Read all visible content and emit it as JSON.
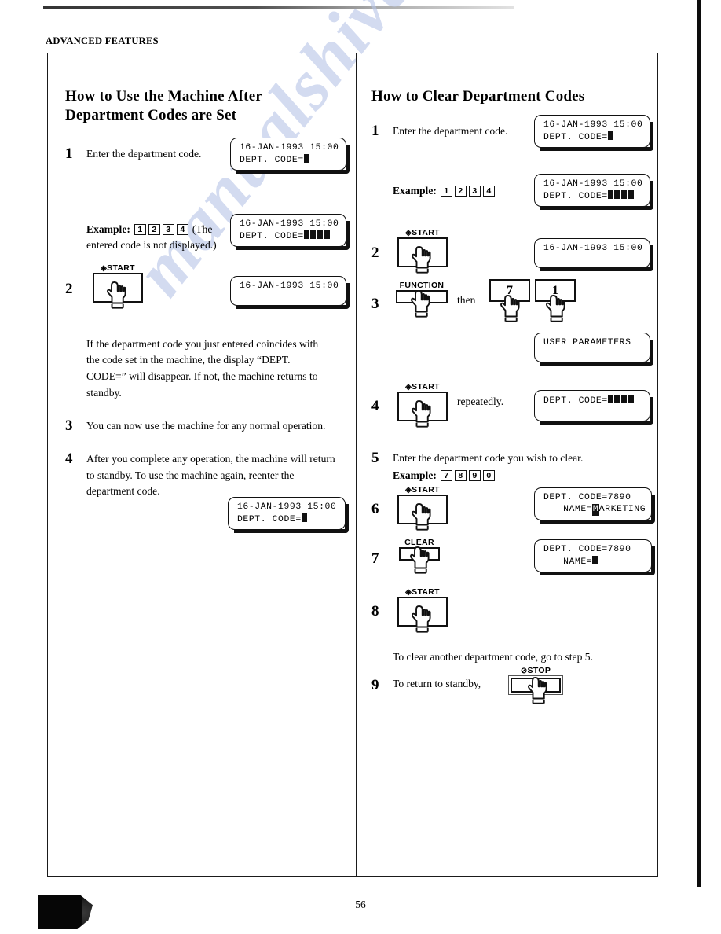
{
  "page": {
    "running_head": "ADVANCED FEATURES",
    "page_number": "56",
    "watermark": "manualshive.com"
  },
  "left_column": {
    "title": "How to Use the Machine After Department Codes are Set",
    "steps": [
      {
        "num": "1",
        "text": "Enter the department code.",
        "lcd": {
          "line1": "16-JAN-1993 15:00",
          "line2_prefix": "DEPT. CODE=",
          "cursor": "block"
        }
      },
      {
        "num": "",
        "example_label": "Example:",
        "example_keys": [
          "1",
          "2",
          "3",
          "4"
        ],
        "example_trailing": "(The entered code is not displayed.)",
        "lcd": {
          "line1": "16-JAN-1993 15:00",
          "line2_prefix": "DEPT. CODE=",
          "cursor": "blocks4"
        }
      },
      {
        "num": "2",
        "button": {
          "label": "START",
          "glyph": "start-diamond"
        },
        "lcd": {
          "line1": "16-JAN-1993 15:00",
          "line2_prefix": "",
          "cursor": "none"
        }
      },
      {
        "num": "",
        "text": "If the department code you just entered coincides with the code set in the machine, the display “DEPT. CODE=” will disappear.  If not, the machine returns to standby."
      },
      {
        "num": "3",
        "text": "You can now use the machine for any normal operation."
      },
      {
        "num": "4",
        "text": "After you complete any operation, the machine will return to standby.  To use the machine again, reenter the department code.",
        "lcd": {
          "line1": "16-JAN-1993 15:00",
          "line2_prefix": "DEPT. CODE=",
          "cursor": "block"
        }
      }
    ]
  },
  "right_column": {
    "title": "How to Clear Department Codes",
    "then_label": "then",
    "repeatedly_label": "repeatedly.",
    "note_step5": "To clear another department code, go to step 5.",
    "steps": [
      {
        "num": "1",
        "text": "Enter the department code.",
        "lcd": {
          "line1": "16-JAN-1993 15:00",
          "line2_prefix": "DEPT. CODE=",
          "cursor": "block"
        }
      },
      {
        "num": "",
        "example_label": "Example:",
        "example_keys": [
          "1",
          "2",
          "3",
          "4"
        ],
        "lcd": {
          "line1": "16-JAN-1993 15:00",
          "line2_prefix": "DEPT. CODE=",
          "cursor": "blocks4"
        }
      },
      {
        "num": "2",
        "button": {
          "label": "START",
          "glyph": "start-diamond"
        },
        "lcd": {
          "line1": "16-JAN-1993 15:00",
          "line2_prefix": "",
          "cursor": "none"
        }
      },
      {
        "num": "3",
        "button": {
          "label": "FUNCTION",
          "glyph": "none"
        },
        "keys": [
          "7",
          "1"
        ],
        "lcd": {
          "line1": "USER PARAMETERS",
          "line2_prefix": "",
          "cursor": "none"
        }
      },
      {
        "num": "4",
        "button": {
          "label": "START",
          "glyph": "start-diamond"
        },
        "lcd": {
          "line1": "DEPT. CODE=",
          "line2_prefix": "",
          "cursor": "blocks4-inline"
        }
      },
      {
        "num": "5",
        "text": "Enter the department code you wish to clear.",
        "example_label": "Example:",
        "example_keys": [
          "7",
          "8",
          "9",
          "0"
        ]
      },
      {
        "num": "6",
        "button": {
          "label": "START",
          "glyph": "start-diamond"
        },
        "lcd": {
          "line1": "DEPT. CODE=7890",
          "line2": "NAME=MARKETING",
          "name_inverted_char": "M"
        }
      },
      {
        "num": "7",
        "button": {
          "label": "CLEAR",
          "glyph": "none"
        },
        "lcd": {
          "line1": "DEPT. CODE=7890",
          "line2_prefix": "NAME=",
          "cursor": "block"
        }
      },
      {
        "num": "8",
        "button": {
          "label": "START",
          "glyph": "start-diamond"
        }
      },
      {
        "num": "9",
        "text": "To return to standby,",
        "button": {
          "label": "STOP",
          "glyph": "stop-circle"
        }
      }
    ]
  }
}
